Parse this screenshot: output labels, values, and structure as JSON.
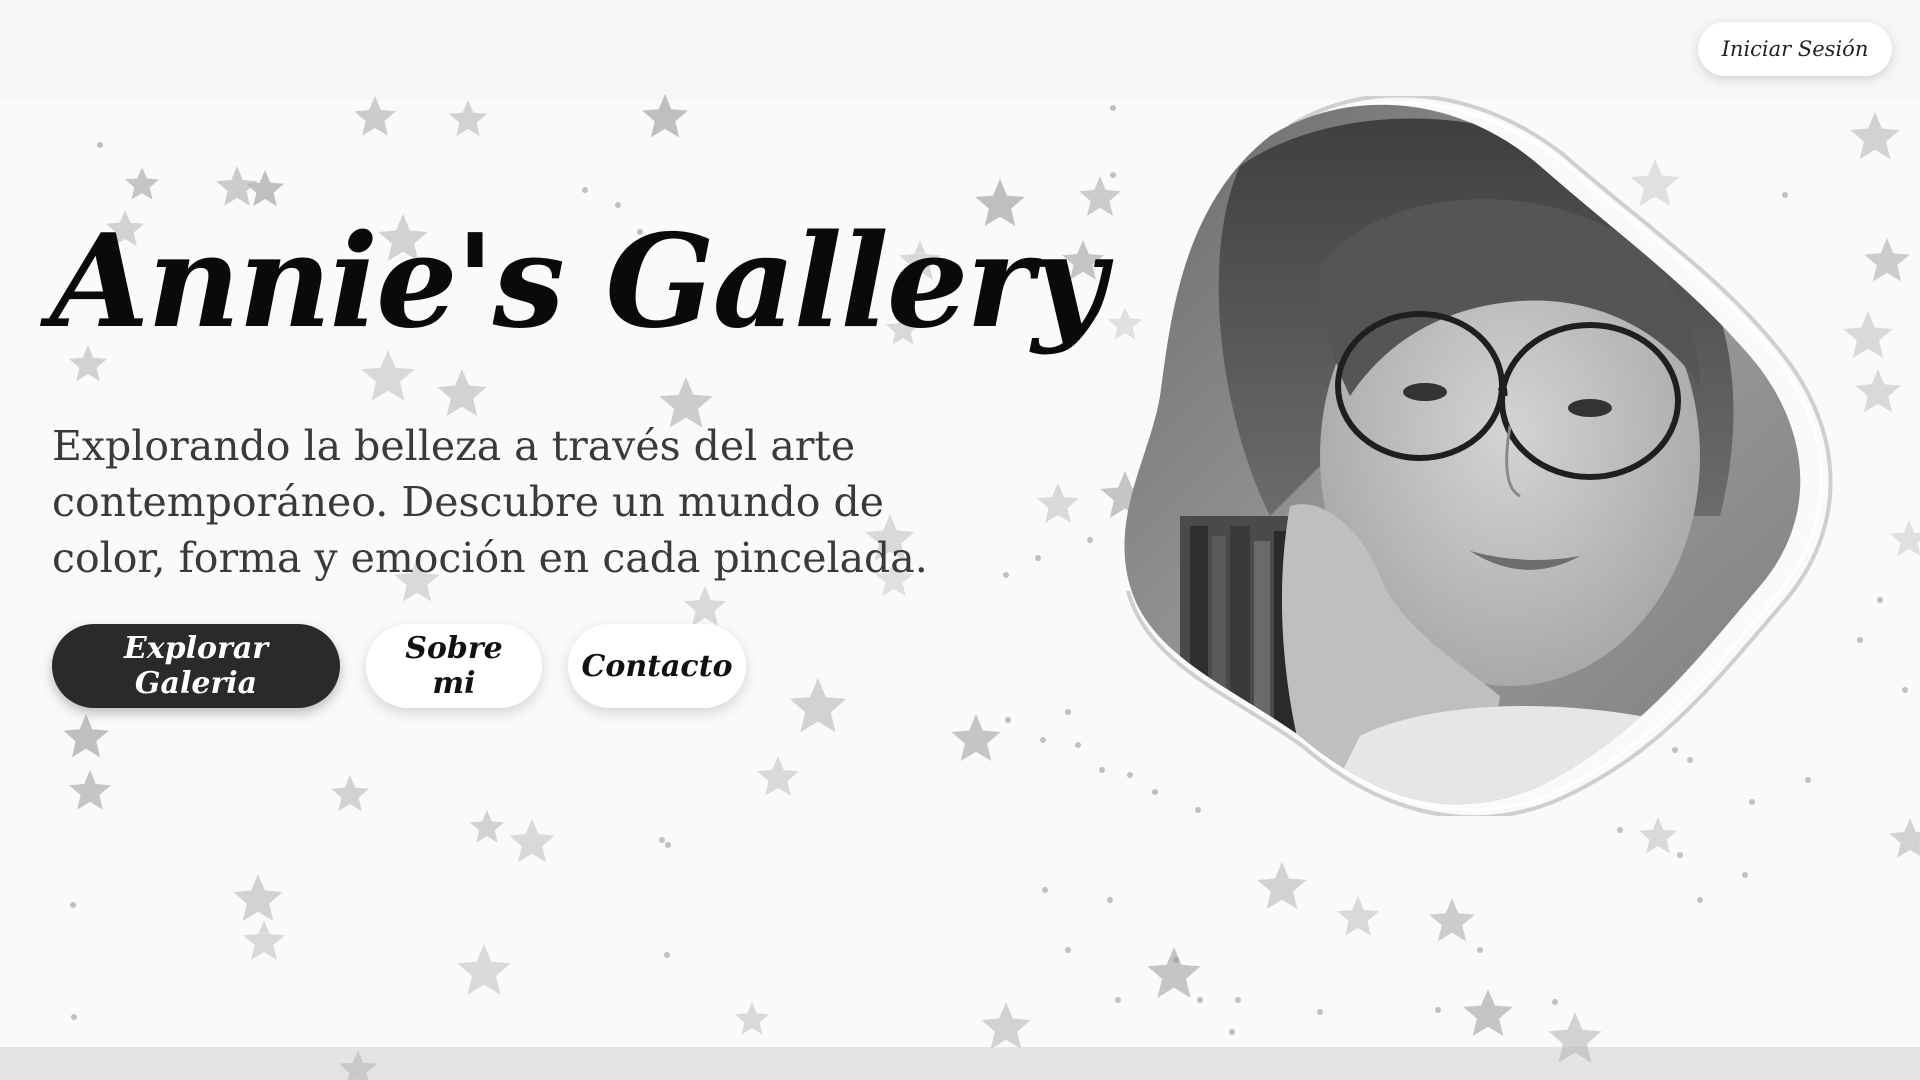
{
  "header": {
    "login_label": "Iniciar Sesión"
  },
  "hero": {
    "title": "Annie's Gallery",
    "subtitle": "Explorando la belleza a través del arte contemporáneo. Descubre un mundo de color, forma y emoción en cada pincelada.",
    "buttons": {
      "explore_label": "Explorar Galeria",
      "about_label": "Sobre mi",
      "contact_label": "Contacto"
    }
  },
  "theme": {
    "primary_button_color": "#2a2a2a",
    "background_color": "#fafafa",
    "star_color": "#b8b8b8",
    "title_color": "#0a0a0a"
  },
  "decor": {
    "background_icon": "star-icon",
    "portrait": "grayscale-selfie-photo"
  }
}
